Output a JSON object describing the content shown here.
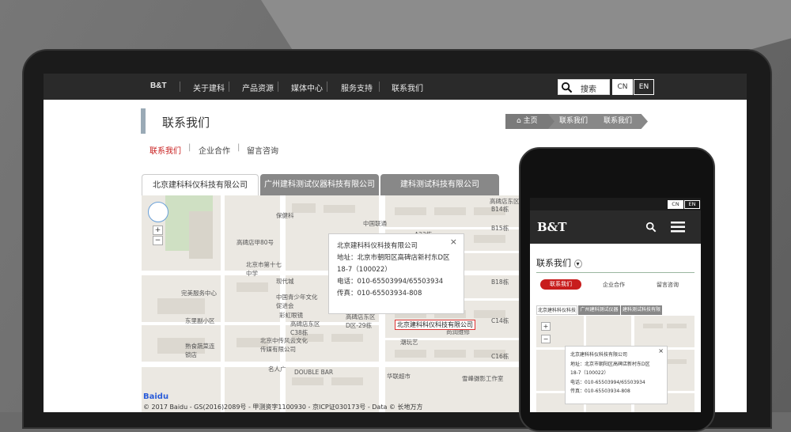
{
  "nav": {
    "logo": "B&T",
    "items": [
      "关于建科",
      "产品资源",
      "媒体中心",
      "服务支持",
      "联系我们"
    ],
    "search_label": "搜索",
    "lang_cn": "CN",
    "lang_en": "EN"
  },
  "page": {
    "title": "联系我们",
    "breadcrumb": [
      "主页",
      "联系我们",
      "联系我们"
    ],
    "subnav": [
      "联系我们",
      "企业合作",
      "留言咨询"
    ],
    "tabs": [
      "北京建科科仪科技有限公司",
      "广州建科测试仪器科技有限公司",
      "建科测试科技有限公司"
    ]
  },
  "map": {
    "popup": {
      "name": "北京建科科仪科技有限公司",
      "address_line1": "地址：北京市朝阳区高碑店新村东D区",
      "address_line2": "18-7（100022）",
      "phone": "电话：010-65503994/65503934",
      "fax": "传真：010-65503934-808",
      "close": "×"
    },
    "marker": "北京建科科仪科技有限公司",
    "labels": [
      "保健科",
      "中国联通",
      "高碑店东区",
      "高碑店甲80号",
      "北京市第十七中学",
      "现代城",
      "中国青少年文化促进会",
      "完美服务中心",
      "彩虹眼镜",
      "东里副小区",
      "高碑店东区C38栋",
      "高碑店东区D区-29栋",
      "北京中传风云文化传媒有限公司",
      "熟食蔬菜连锁店",
      "名人广",
      "DOUBLE BAR",
      "华联超市",
      "雪峰摄影工作室",
      "潮玩艺",
      "尚润维修",
      "A23栋",
      "B14栋",
      "B15栋",
      "B18栋",
      "C14栋",
      "C16栋"
    ],
    "baidu": "Baidu",
    "copyright": "© 2017 Baidu - GS(2016)2089号 - 甲测资字1100930 - 京ICP证030173号 - Data © 长地万方"
  },
  "phone": {
    "lang_cn": "CN",
    "lang_en": "EN",
    "logo": "B&T",
    "title": "联系我们",
    "subnav": [
      "联系我们",
      "企业合作",
      "留言咨询"
    ],
    "tabs": [
      "北京建科科仪科技",
      "广州建科测试仪器",
      "建科测试科技有限"
    ],
    "popup": {
      "name": "北京建科科仪科技有限公司",
      "address_line1": "地址：北京市朝阳区高碑店新村东D区",
      "address_line2": "18-7（100022）",
      "phone": "电话：010-65503994/65503934",
      "fax": "传真：010-65503934-808",
      "close": "×"
    }
  },
  "colors": {
    "nav_bg": "#2a2a2a",
    "accent_red": "#c81d1d",
    "tab_gray": "#888888"
  }
}
